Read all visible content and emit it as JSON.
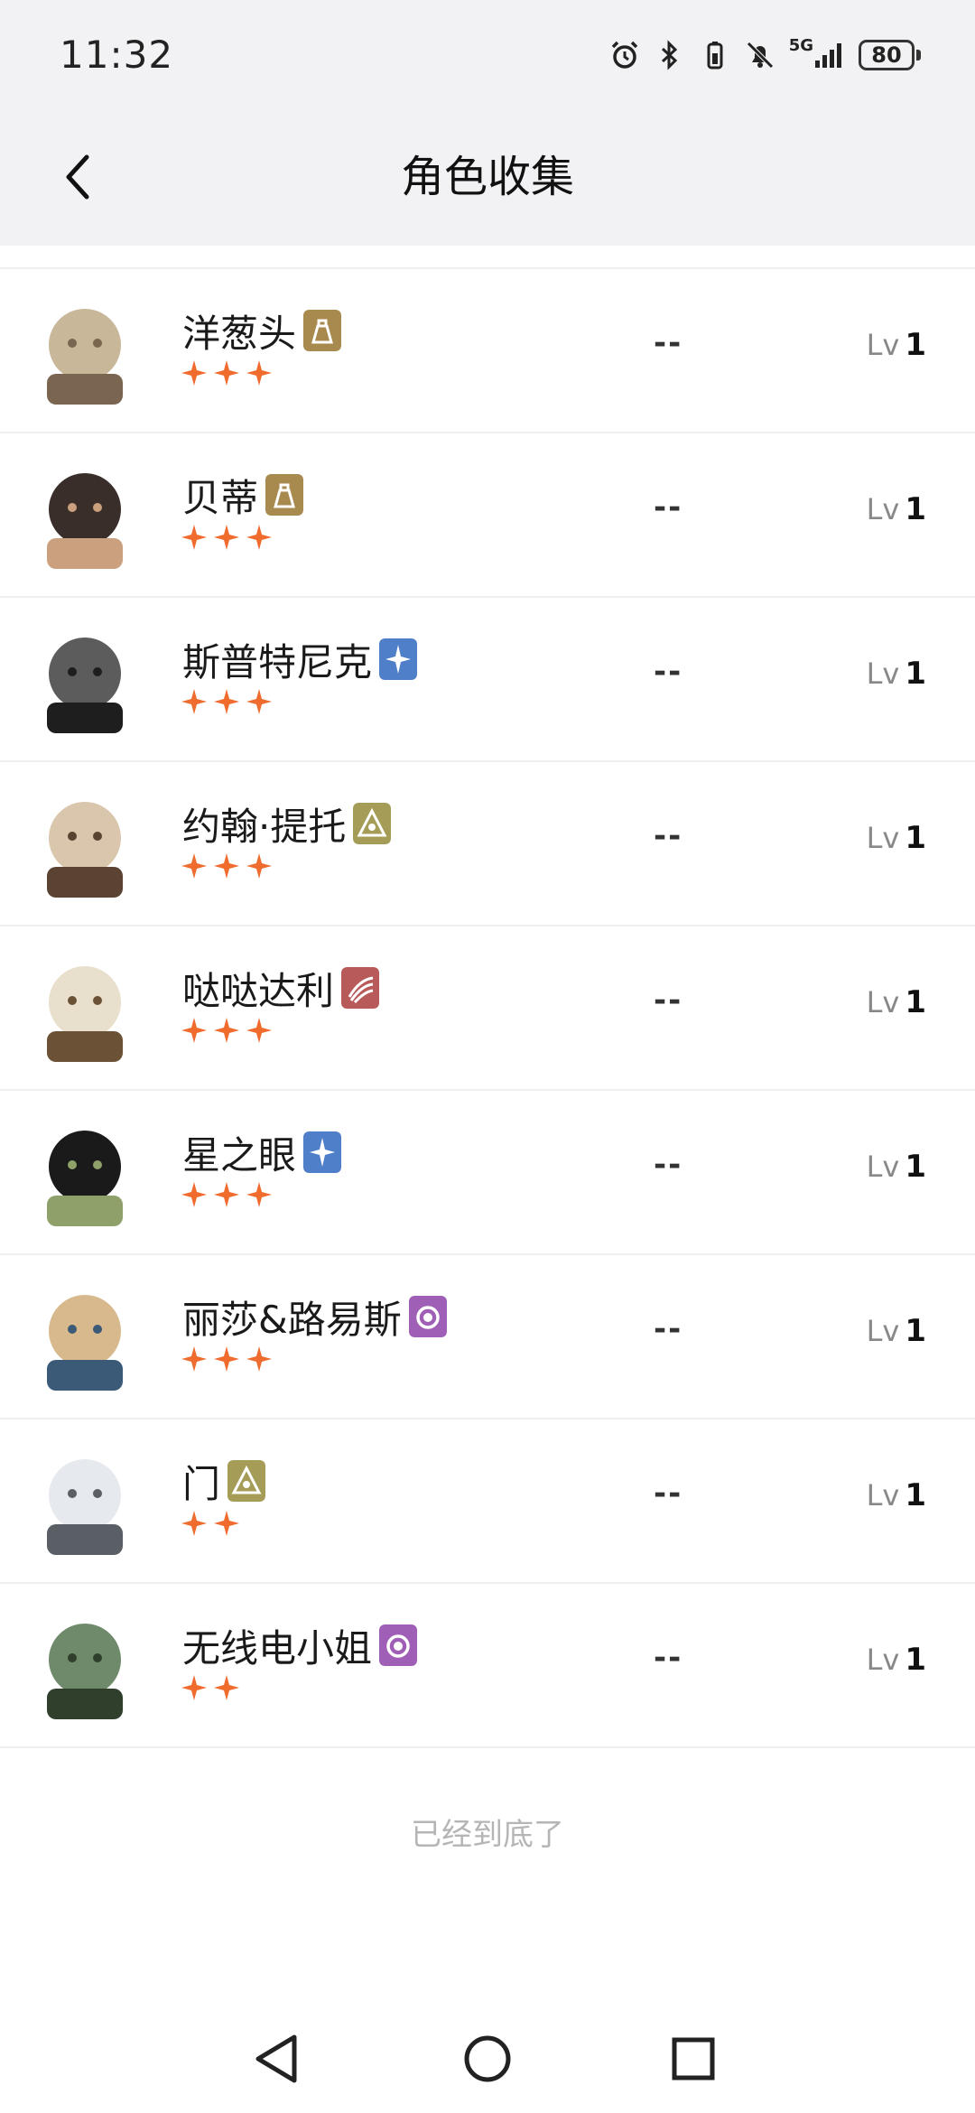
{
  "status_bar": {
    "time": "11:32",
    "network": "5G",
    "battery": "80",
    "icons": [
      "alarm-icon",
      "bluetooth-icon",
      "battery-saver-icon",
      "mute-icon",
      "signal-icon",
      "battery-icon"
    ]
  },
  "header": {
    "title": "角色收集",
    "back_icon": "chevron-left-icon"
  },
  "colors": {
    "star": "#ef6c2e",
    "badge_gold": "#a88a4e",
    "badge_blue": "#4f7fc8",
    "badge_olive": "#a59c58",
    "badge_red": "#b95a5a",
    "badge_purple": "#a05fb6"
  },
  "roles": [
    {
      "name": "洋葱头",
      "badge": "badge_gold",
      "stars": 3,
      "value": "--",
      "lv_label": "Lv",
      "level": "1"
    },
    {
      "name": "贝蒂",
      "badge": "badge_gold",
      "stars": 3,
      "value": "--",
      "lv_label": "Lv",
      "level": "1"
    },
    {
      "name": "斯普特尼克",
      "badge": "badge_blue",
      "stars": 3,
      "value": "--",
      "lv_label": "Lv",
      "level": "1"
    },
    {
      "name": "约翰·提托",
      "badge": "badge_olive",
      "stars": 3,
      "value": "--",
      "lv_label": "Lv",
      "level": "1"
    },
    {
      "name": "哒哒达利",
      "badge": "badge_red",
      "stars": 3,
      "value": "--",
      "lv_label": "Lv",
      "level": "1"
    },
    {
      "name": "星之眼",
      "badge": "badge_blue",
      "stars": 3,
      "value": "--",
      "lv_label": "Lv",
      "level": "1"
    },
    {
      "name": "丽莎&路易斯",
      "badge": "badge_purple",
      "stars": 3,
      "value": "--",
      "lv_label": "Lv",
      "level": "1"
    },
    {
      "name": "门",
      "badge": "badge_olive",
      "stars": 2,
      "value": "--",
      "lv_label": "Lv",
      "level": "1"
    },
    {
      "name": "无线电小姐",
      "badge": "badge_purple",
      "stars": 2,
      "value": "--",
      "lv_label": "Lv",
      "level": "1"
    }
  ],
  "footer": {
    "end_hint": "已经到底了"
  },
  "system_nav": {
    "back": "triangle-back-icon",
    "home": "circle-home-icon",
    "recents": "square-recents-icon"
  }
}
